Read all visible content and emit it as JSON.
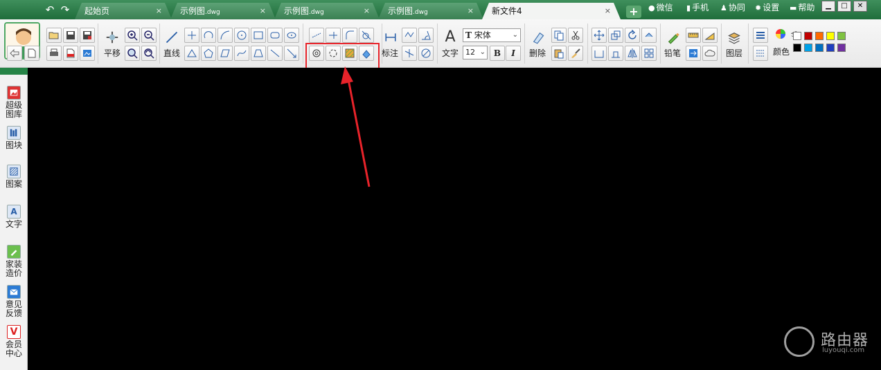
{
  "tabs": [
    {
      "label": "起始页",
      "suffix": "",
      "active": false
    },
    {
      "label": "示例图",
      "suffix": ".dwg",
      "active": false
    },
    {
      "label": "示例图",
      "suffix": ".dwg",
      "active": false
    },
    {
      "label": "示例图",
      "suffix": ".dwg",
      "active": false
    },
    {
      "label": "新文件4",
      "suffix": "",
      "active": true
    }
  ],
  "tab_close": "×",
  "add_tab": "+",
  "title_links": {
    "wechat": "微信",
    "mobile": "手机",
    "collab": "协同",
    "settings": "设置",
    "help": "帮助"
  },
  "toolbar": {
    "pan": "平移",
    "line": "直线",
    "dimension": "标注",
    "text": "文字",
    "font_name": "宋体",
    "font_size": "12",
    "bold": "B",
    "italic": "I",
    "delete": "删除",
    "pencil": "铅笔",
    "layer": "图层",
    "color": "颜色"
  },
  "colors": {
    "row1": [
      "#ffffff",
      "#c00000",
      "#ff6a00",
      "#ffff00",
      "#7fc241"
    ],
    "row2": [
      "#000000",
      "#00a2e8",
      "#0070c0",
      "#1f3fbf",
      "#7030a0"
    ],
    "highlight": "#e8232a",
    "accent": "#268447"
  },
  "side": [
    {
      "line1": "超级",
      "line2": "图库",
      "icon": "gallery-icon"
    },
    {
      "line1": "图块",
      "line2": "",
      "icon": "blocks-icon"
    },
    {
      "line1": "图案",
      "line2": "",
      "icon": "pattern-icon"
    },
    {
      "line1": "文字",
      "line2": "",
      "icon": "text-icon"
    },
    {
      "line1": "家装",
      "line2": "造价",
      "icon": "cost-icon"
    },
    {
      "line1": "意见",
      "line2": "反馈",
      "icon": "feedback-icon"
    },
    {
      "line1": "会员",
      "line2": "中心",
      "icon": "vip-icon"
    }
  ],
  "watermark": {
    "name": "路由器",
    "url": "luyouqi.com"
  }
}
